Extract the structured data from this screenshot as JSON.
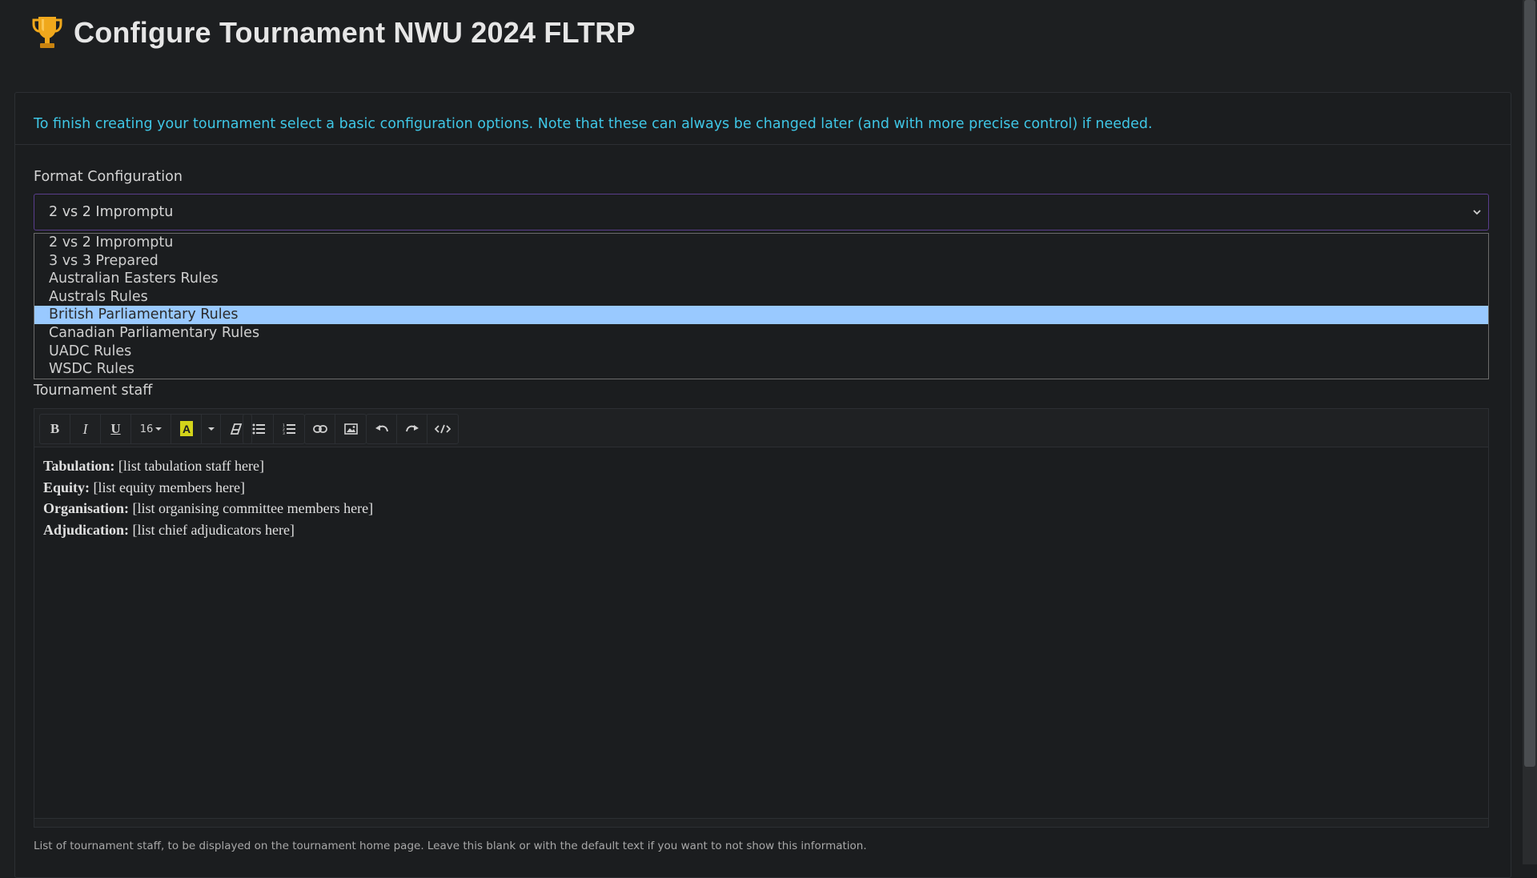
{
  "header": {
    "title": "Configure Tournament NWU 2024 FLTRP",
    "icon": "trophy-icon"
  },
  "info": "To finish creating your tournament select a basic configuration options. Note that these can always be changed later (and with more precise control) if needed.",
  "format": {
    "label": "Format Configuration",
    "selected": "2 vs 2 Impromptu",
    "options": [
      "2 vs 2 Impromptu",
      "3 vs 3 Prepared",
      "Australian Easters Rules",
      "Australs Rules",
      "British Parliamentary Rules",
      "Canadian Parliamentary Rules",
      "UADC Rules",
      "WSDC Rules"
    ],
    "highlighted": "British Parliamentary Rules"
  },
  "staff": {
    "label": "Tournament staff",
    "toolbar": {
      "font_size": "16"
    },
    "lines": [
      {
        "key": "Tabulation:",
        "value": "[list tabulation staff here]"
      },
      {
        "key": "Equity:",
        "value": "[list equity members here]"
      },
      {
        "key": "Organisation:",
        "value": "[list organising committee members here]"
      },
      {
        "key": "Adjudication:",
        "value": "[list chief adjudicators here]"
      }
    ],
    "help": "List of tournament staff, to be displayed on the tournament home page. Leave this blank or with the default text if you want to not show this information."
  },
  "colors": {
    "accent": "#3fc7e6",
    "select_border": "#5a3e8c",
    "highlight": "#99c9ff",
    "trophy": "#f0a81c"
  }
}
